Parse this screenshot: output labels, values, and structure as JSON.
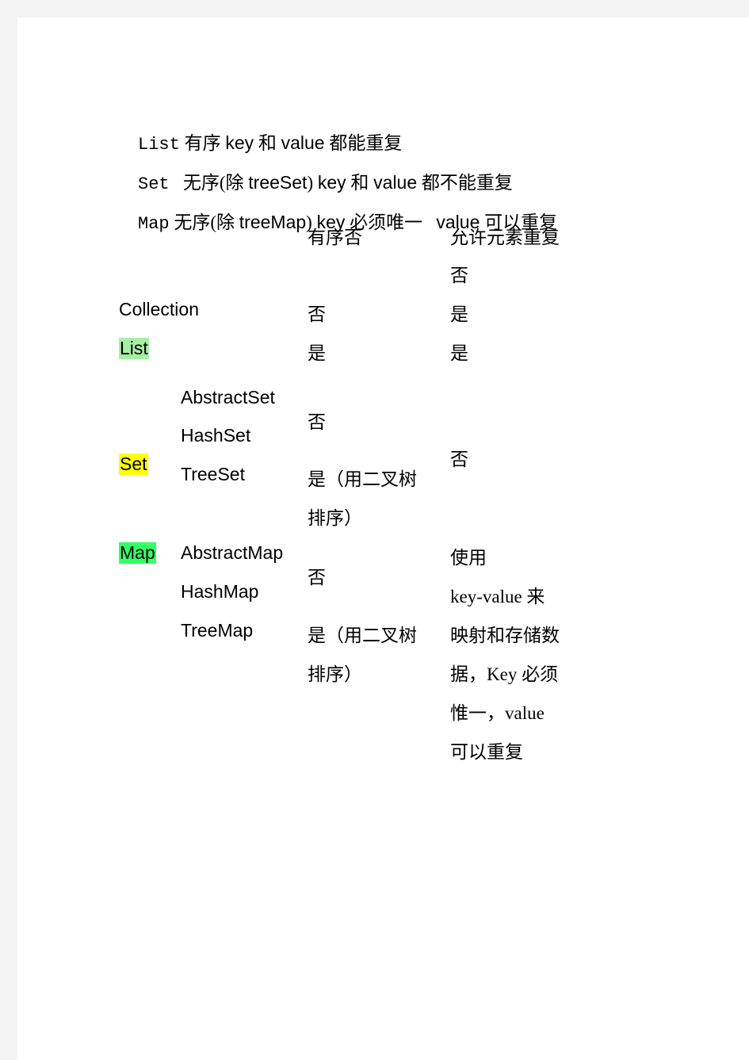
{
  "document": {
    "intro_lines": [
      {
        "head": "List",
        "body_segments": [
          {
            "text": " 有序 ",
            "script": "cn"
          },
          {
            "text": "key",
            "script": "lat"
          },
          {
            "text": " 和 ",
            "script": "cn"
          },
          {
            "text": "value",
            "script": "lat"
          },
          {
            "text": " 都能重复",
            "script": "cn"
          }
        ],
        "plain": "List 有序 key 和 value 都能重复"
      },
      {
        "head": "Set",
        "body_segments": [
          {
            "text": "   无序(除 ",
            "script": "cn"
          },
          {
            "text": "treeSet",
            "script": "lat"
          },
          {
            "text": ") ",
            "script": "cn"
          },
          {
            "text": "key",
            "script": "lat"
          },
          {
            "text": " 和 ",
            "script": "cn"
          },
          {
            "text": "value",
            "script": "lat"
          },
          {
            "text": " 都不能重复",
            "script": "cn"
          }
        ],
        "plain": "Set   无序(除 treeSet) key 和 value 都不能重复"
      },
      {
        "head": "Map",
        "body_segments": [
          {
            "text": " 无序(除 ",
            "script": "cn"
          },
          {
            "text": "treeMap",
            "script": "lat"
          },
          {
            "text": ") ",
            "script": "cn"
          },
          {
            "text": "key",
            "script": "lat"
          },
          {
            "text": " 必须唯一   ",
            "script": "cn"
          },
          {
            "text": "value",
            "script": "lat"
          },
          {
            "text": " 可以重复",
            "script": "cn"
          }
        ],
        "plain": "Map 无序(除 treeMap) key 必须唯一   value 可以重复"
      }
    ],
    "table": {
      "headers": {
        "ordered": "有序否",
        "duplicates": "允许元素重复"
      },
      "header_extra_value": "否",
      "rows": [
        {
          "tag": "",
          "tag_highlight": "none",
          "name": "Collection",
          "ordered": "否",
          "duplicates": "是"
        },
        {
          "tag": "List",
          "tag_highlight": "green-pale",
          "name": "",
          "ordered": "是",
          "duplicates": "是"
        }
      ],
      "set_group": {
        "tag": "Set",
        "tag_highlight": "yellow",
        "names": [
          "AbstractSet",
          "HashSet",
          "TreeSet"
        ],
        "ordered_first": "否",
        "ordered_tree_line1": "是（用二叉树",
        "ordered_tree_line2": "排序）",
        "duplicates": "否"
      },
      "map_group": {
        "tag": "Map",
        "tag_highlight": "green-bright",
        "names": [
          "AbstractMap",
          "HashMap",
          "TreeMap"
        ],
        "ordered_first": "否",
        "ordered_tree_line1": "是（用二叉树",
        "ordered_tree_line2": "排序）",
        "duplicates_lines": [
          "使用",
          "key-value 来",
          "映射和存储数",
          "据，Key 必须",
          "惟一，value",
          "可以重复"
        ]
      }
    }
  },
  "colors": {
    "page_background": "#ffffff",
    "canvas_background": "#f3f3f3",
    "text": "#000000",
    "highlight_green_pale": "#a6f0a6",
    "highlight_yellow": "#ffff00",
    "highlight_green_bright": "#33ff66"
  }
}
